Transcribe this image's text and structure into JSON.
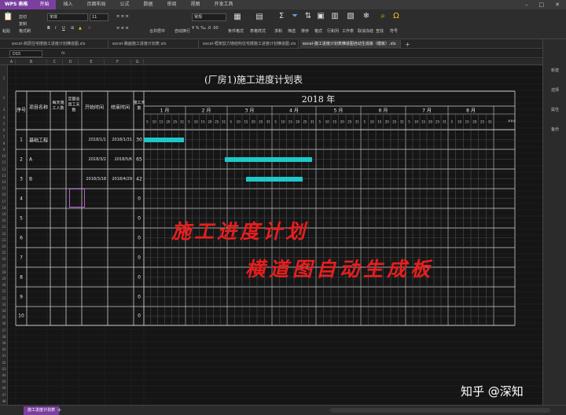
{
  "app": {
    "name": "WPS 表格",
    "menus": [
      "开始",
      "插入",
      "页面布局",
      "公式",
      "数据",
      "审阅",
      "视图",
      "开发工具"
    ],
    "active_menu": "开始"
  },
  "ribbon": {
    "paste": "粘贴",
    "cut": "剪切",
    "copy": "复制",
    "format_painter": "格式刷",
    "font_name": "宋体",
    "font_size": "11",
    "merge": "合并居中",
    "wrap": "自动换行",
    "number_format": "常规",
    "conditional": "条件格式",
    "table_style": "表格样式",
    "sum": "求和",
    "filter": "筛选",
    "sort": "排序",
    "format": "格式",
    "rowcol": "行和列",
    "sheet": "工作表",
    "freeze": "取消冻结",
    "find": "查找",
    "symbol": "符号"
  },
  "file_tabs": [
    "excel-高层住宅楼施工进度计划横道图.xls",
    "excel-路面施工进度计划表.xls",
    "excel-框架剪力墙结构住宅楼施工进度计划横道图.xls",
    "excel-施工进度计划表横道图自动生成板（模板）.xls"
  ],
  "active_file_tab": 3,
  "formula_bar": {
    "cell_ref": "D15",
    "fx": "fx"
  },
  "columns": [
    "A",
    "B",
    "C",
    "D",
    "E",
    "F",
    "G"
  ],
  "sheet": {
    "title": "(厂房1)施工进度计划表",
    "year_label": "2018 年",
    "headers": {
      "seq": "序号",
      "name": "项目名称",
      "workers": "每天施工人数",
      "total_days": "定额总用工天数",
      "start": "开始时间",
      "end": "结束时间",
      "days": "施工天数"
    },
    "months": [
      "1 月",
      "2 月",
      "3 月",
      "4 月",
      "5 月",
      "6 月",
      "7 月",
      "8 月"
    ],
    "more_marker": "###",
    "day_marks": [
      "5",
      "10",
      "15",
      "20",
      "25",
      "31"
    ],
    "tasks": [
      {
        "seq": "1",
        "name": "基础工程",
        "start": "2018/1/1",
        "end": "2018/1/31",
        "days": "30",
        "bar_start": 0,
        "bar_len": 30
      },
      {
        "seq": "2",
        "name": "A",
        "start": "2018/3/2",
        "end": "2018/5/6",
        "days": "65",
        "bar_start": 60,
        "bar_len": 65
      },
      {
        "seq": "3",
        "name": "B",
        "start": "2018/3/18",
        "end": "2018/4/29",
        "days": "42",
        "bar_start": 76,
        "bar_len": 42
      },
      {
        "seq": "4",
        "name": "",
        "start": "",
        "end": "",
        "days": "0"
      },
      {
        "seq": "5",
        "name": "",
        "start": "",
        "end": "",
        "days": "0"
      },
      {
        "seq": "6",
        "name": "",
        "start": "",
        "end": "",
        "days": "0"
      },
      {
        "seq": "7",
        "name": "",
        "start": "",
        "end": "",
        "days": "0"
      },
      {
        "seq": "8",
        "name": "",
        "start": "",
        "end": "",
        "days": "0"
      },
      {
        "seq": "9",
        "name": "",
        "start": "",
        "end": "",
        "days": "0"
      },
      {
        "seq": "10",
        "name": "",
        "start": "",
        "end": "",
        "days": "0"
      }
    ]
  },
  "overlay": {
    "line1": "施工进度计划",
    "line2": "横道图自动生成板"
  },
  "right_pane": [
    "新建",
    "选择",
    "属性",
    "备份"
  ],
  "sheet_tab": "施工进度计划表",
  "watermark": "知乎 @深知",
  "colors": {
    "bar": "#1fc8c8",
    "accent": "#7b3fa0",
    "overlay_text": "#e81e1e"
  }
}
